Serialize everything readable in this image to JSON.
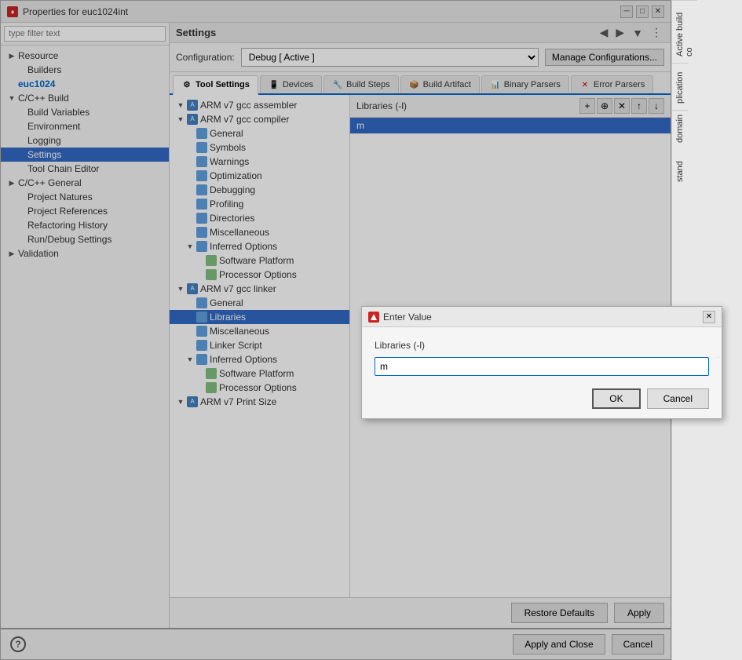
{
  "window": {
    "title": "Properties for euc1024int",
    "title_icon": "♦"
  },
  "sidebar": {
    "filter_placeholder": "type filter text",
    "items": [
      {
        "id": "resource",
        "label": "Resource",
        "level": 1,
        "expanded": false
      },
      {
        "id": "builders",
        "label": "Builders",
        "level": 2,
        "expanded": false
      },
      {
        "id": "euc1024",
        "label": "euc1024",
        "level": 1,
        "expanded": false
      },
      {
        "id": "cpp-build",
        "label": "C/C++ Build",
        "level": 1,
        "expanded": true
      },
      {
        "id": "build-variables",
        "label": "Build Variables",
        "level": 2
      },
      {
        "id": "environment",
        "label": "Environment",
        "level": 2
      },
      {
        "id": "logging",
        "label": "Logging",
        "level": 2
      },
      {
        "id": "settings",
        "label": "Settings",
        "level": 2,
        "selected": true
      },
      {
        "id": "toolchain-editor",
        "label": "Tool Chain Editor",
        "level": 2
      },
      {
        "id": "cpp-general",
        "label": "C/C++ General",
        "level": 1,
        "expanded": false
      },
      {
        "id": "project-natures",
        "label": "Project Natures",
        "level": 2
      },
      {
        "id": "project-references",
        "label": "Project References",
        "level": 2
      },
      {
        "id": "refactoring-history",
        "label": "Refactoring History",
        "level": 2
      },
      {
        "id": "run-debug",
        "label": "Run/Debug Settings",
        "level": 2
      },
      {
        "id": "validation",
        "label": "Validation",
        "level": 1
      }
    ]
  },
  "settings_panel": {
    "title": "Settings",
    "config_label": "Configuration:",
    "config_value": "Debug [ Active ]",
    "manage_btn": "Manage Configurations...",
    "tabs": [
      {
        "id": "tool-settings",
        "label": "Tool Settings",
        "icon": "⚙",
        "active": true
      },
      {
        "id": "devices",
        "label": "Devices",
        "icon": "📱"
      },
      {
        "id": "build-steps",
        "label": "Build Steps",
        "icon": "🔧"
      },
      {
        "id": "build-artifact",
        "label": "Build Artifact",
        "icon": "📦"
      },
      {
        "id": "binary-parsers",
        "label": "Binary Parsers",
        "icon": "📊"
      },
      {
        "id": "error-parsers",
        "label": "Error Parsers",
        "icon": "⚠"
      }
    ]
  },
  "tool_tree": {
    "items": [
      {
        "id": "arm-v7-assembler",
        "label": "ARM v7 gcc assembler",
        "level": 1,
        "expanded": true
      },
      {
        "id": "arm-v7-compiler",
        "label": "ARM v7 gcc compiler",
        "level": 1,
        "expanded": true
      },
      {
        "id": "general-compiler",
        "label": "General",
        "level": 2
      },
      {
        "id": "symbols",
        "label": "Symbols",
        "level": 2
      },
      {
        "id": "warnings",
        "label": "Warnings",
        "level": 2
      },
      {
        "id": "optimization",
        "label": "Optimization",
        "level": 2
      },
      {
        "id": "debugging",
        "label": "Debugging",
        "level": 2
      },
      {
        "id": "profiling",
        "label": "Profiling",
        "level": 2
      },
      {
        "id": "directories",
        "label": "Directories",
        "level": 2
      },
      {
        "id": "miscellaneous",
        "label": "Miscellaneous",
        "level": 2
      },
      {
        "id": "inferred-options-compiler",
        "label": "Inferred Options",
        "level": 2,
        "expanded": true
      },
      {
        "id": "software-platform-compiler",
        "label": "Software Platform",
        "level": 3
      },
      {
        "id": "processor-options-compiler",
        "label": "Processor Options",
        "level": 3
      },
      {
        "id": "arm-v7-linker",
        "label": "ARM v7 gcc linker",
        "level": 1,
        "expanded": true
      },
      {
        "id": "general-linker",
        "label": "General",
        "level": 2
      },
      {
        "id": "libraries",
        "label": "Libraries",
        "level": 2,
        "selected": true
      },
      {
        "id": "miscellaneous-linker",
        "label": "Miscellaneous",
        "level": 2
      },
      {
        "id": "linker-script",
        "label": "Linker Script",
        "level": 2
      },
      {
        "id": "inferred-options-linker",
        "label": "Inferred Options",
        "level": 2,
        "expanded": true
      },
      {
        "id": "software-platform-linker",
        "label": "Software Platform",
        "level": 3
      },
      {
        "id": "processor-options-linker",
        "label": "Processor Options",
        "level": 3
      },
      {
        "id": "arm-v7-print-size",
        "label": "ARM v7 Print Size",
        "level": 1
      }
    ]
  },
  "properties_panel": {
    "title": "Libraries (-l)",
    "action_buttons": [
      "add",
      "add-from-workspace",
      "delete",
      "up",
      "down"
    ],
    "items": [
      {
        "id": "lib-m",
        "label": "m",
        "selected": true
      }
    ]
  },
  "bottom_buttons": {
    "restore_defaults": "Restore Defaults",
    "apply": "Apply"
  },
  "final_buttons": {
    "apply_close": "Apply and Close",
    "cancel": "Cancel",
    "help": "?"
  },
  "enter_value_dialog": {
    "title": "Enter Value",
    "field_label": "Libraries (-l)",
    "input_value": "m",
    "ok_label": "OK",
    "cancel_label": "Cancel"
  },
  "right_side_labels": {
    "active_build_co": "Active build co",
    "plication": "plication",
    "domain": "domain",
    "standard": "stand"
  }
}
